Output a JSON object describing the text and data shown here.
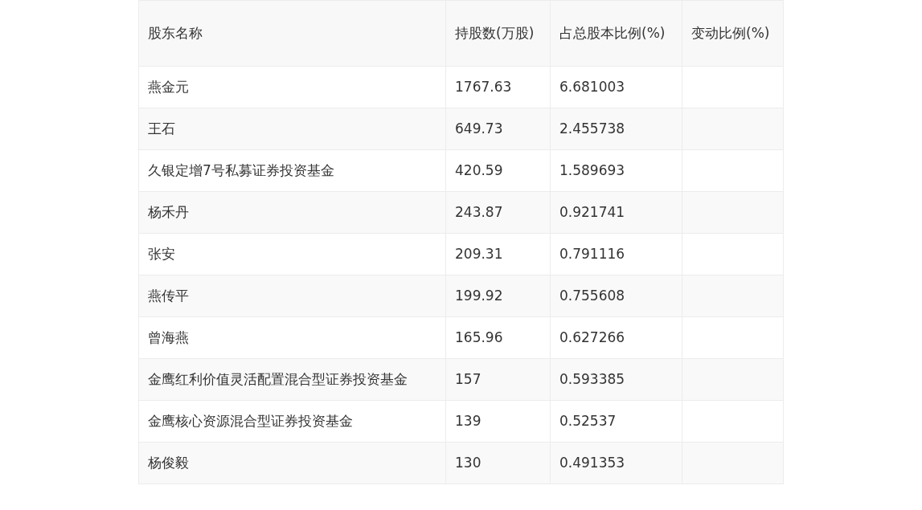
{
  "table": {
    "columns": [
      "股东名称",
      "持股数(万股)",
      "占总股本比例(%)",
      "变动比例(%)"
    ],
    "rows": [
      {
        "name": "燕金元",
        "shares": "1767.63",
        "ratio": "6.681003"
      },
      {
        "name": "王石",
        "shares": "649.73",
        "ratio": "2.455738"
      },
      {
        "name": "久银定增7号私募证券投资基金",
        "shares": "420.59",
        "ratio": "1.589693"
      },
      {
        "name": "杨禾丹",
        "shares": "243.87",
        "ratio": "0.921741"
      },
      {
        "name": "张安",
        "shares": "209.31",
        "ratio": "0.791116"
      },
      {
        "name": "燕传平",
        "shares": "199.92",
        "ratio": "0.755608"
      },
      {
        "name": "曾海燕",
        "shares": "165.96",
        "ratio": "0.627266"
      },
      {
        "name": "金鹰红利价值灵活配置混合型证券投资基金",
        "shares": "157",
        "ratio": "0.593385"
      },
      {
        "name": "金鹰核心资源混合型证券投资基金",
        "shares": "139",
        "ratio": "0.52537"
      },
      {
        "name": "杨俊毅",
        "shares": "130",
        "ratio": "0.491353"
      }
    ]
  }
}
